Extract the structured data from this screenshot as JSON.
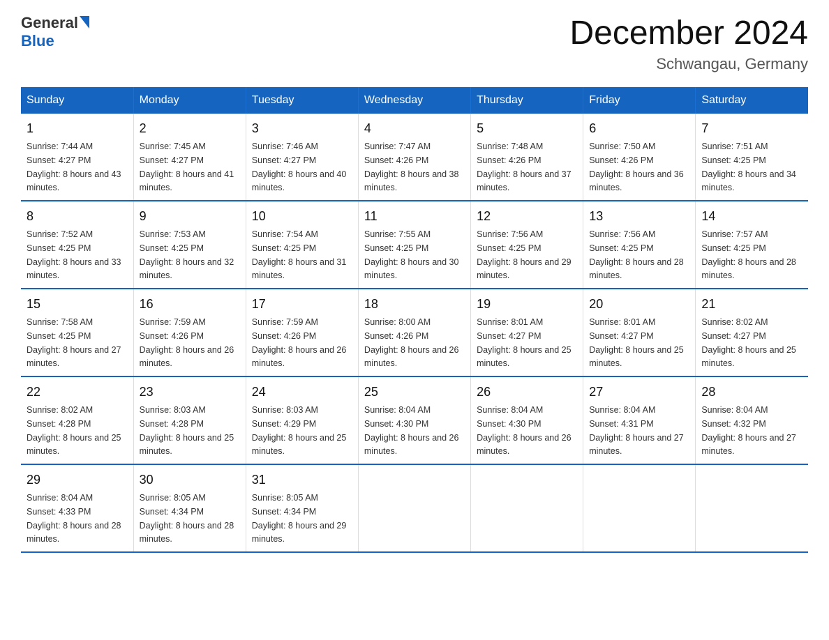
{
  "header": {
    "logo_text_general": "General",
    "logo_text_blue": "Blue",
    "main_title": "December 2024",
    "subtitle": "Schwangau, Germany"
  },
  "calendar": {
    "days_of_week": [
      "Sunday",
      "Monday",
      "Tuesday",
      "Wednesday",
      "Thursday",
      "Friday",
      "Saturday"
    ],
    "weeks": [
      [
        {
          "day": "1",
          "sunrise": "7:44 AM",
          "sunset": "4:27 PM",
          "daylight": "8 hours and 43 minutes."
        },
        {
          "day": "2",
          "sunrise": "7:45 AM",
          "sunset": "4:27 PM",
          "daylight": "8 hours and 41 minutes."
        },
        {
          "day": "3",
          "sunrise": "7:46 AM",
          "sunset": "4:27 PM",
          "daylight": "8 hours and 40 minutes."
        },
        {
          "day": "4",
          "sunrise": "7:47 AM",
          "sunset": "4:26 PM",
          "daylight": "8 hours and 38 minutes."
        },
        {
          "day": "5",
          "sunrise": "7:48 AM",
          "sunset": "4:26 PM",
          "daylight": "8 hours and 37 minutes."
        },
        {
          "day": "6",
          "sunrise": "7:50 AM",
          "sunset": "4:26 PM",
          "daylight": "8 hours and 36 minutes."
        },
        {
          "day": "7",
          "sunrise": "7:51 AM",
          "sunset": "4:25 PM",
          "daylight": "8 hours and 34 minutes."
        }
      ],
      [
        {
          "day": "8",
          "sunrise": "7:52 AM",
          "sunset": "4:25 PM",
          "daylight": "8 hours and 33 minutes."
        },
        {
          "day": "9",
          "sunrise": "7:53 AM",
          "sunset": "4:25 PM",
          "daylight": "8 hours and 32 minutes."
        },
        {
          "day": "10",
          "sunrise": "7:54 AM",
          "sunset": "4:25 PM",
          "daylight": "8 hours and 31 minutes."
        },
        {
          "day": "11",
          "sunrise": "7:55 AM",
          "sunset": "4:25 PM",
          "daylight": "8 hours and 30 minutes."
        },
        {
          "day": "12",
          "sunrise": "7:56 AM",
          "sunset": "4:25 PM",
          "daylight": "8 hours and 29 minutes."
        },
        {
          "day": "13",
          "sunrise": "7:56 AM",
          "sunset": "4:25 PM",
          "daylight": "8 hours and 28 minutes."
        },
        {
          "day": "14",
          "sunrise": "7:57 AM",
          "sunset": "4:25 PM",
          "daylight": "8 hours and 28 minutes."
        }
      ],
      [
        {
          "day": "15",
          "sunrise": "7:58 AM",
          "sunset": "4:25 PM",
          "daylight": "8 hours and 27 minutes."
        },
        {
          "day": "16",
          "sunrise": "7:59 AM",
          "sunset": "4:26 PM",
          "daylight": "8 hours and 26 minutes."
        },
        {
          "day": "17",
          "sunrise": "7:59 AM",
          "sunset": "4:26 PM",
          "daylight": "8 hours and 26 minutes."
        },
        {
          "day": "18",
          "sunrise": "8:00 AM",
          "sunset": "4:26 PM",
          "daylight": "8 hours and 26 minutes."
        },
        {
          "day": "19",
          "sunrise": "8:01 AM",
          "sunset": "4:27 PM",
          "daylight": "8 hours and 25 minutes."
        },
        {
          "day": "20",
          "sunrise": "8:01 AM",
          "sunset": "4:27 PM",
          "daylight": "8 hours and 25 minutes."
        },
        {
          "day": "21",
          "sunrise": "8:02 AM",
          "sunset": "4:27 PM",
          "daylight": "8 hours and 25 minutes."
        }
      ],
      [
        {
          "day": "22",
          "sunrise": "8:02 AM",
          "sunset": "4:28 PM",
          "daylight": "8 hours and 25 minutes."
        },
        {
          "day": "23",
          "sunrise": "8:03 AM",
          "sunset": "4:28 PM",
          "daylight": "8 hours and 25 minutes."
        },
        {
          "day": "24",
          "sunrise": "8:03 AM",
          "sunset": "4:29 PM",
          "daylight": "8 hours and 25 minutes."
        },
        {
          "day": "25",
          "sunrise": "8:04 AM",
          "sunset": "4:30 PM",
          "daylight": "8 hours and 26 minutes."
        },
        {
          "day": "26",
          "sunrise": "8:04 AM",
          "sunset": "4:30 PM",
          "daylight": "8 hours and 26 minutes."
        },
        {
          "day": "27",
          "sunrise": "8:04 AM",
          "sunset": "4:31 PM",
          "daylight": "8 hours and 27 minutes."
        },
        {
          "day": "28",
          "sunrise": "8:04 AM",
          "sunset": "4:32 PM",
          "daylight": "8 hours and 27 minutes."
        }
      ],
      [
        {
          "day": "29",
          "sunrise": "8:04 AM",
          "sunset": "4:33 PM",
          "daylight": "8 hours and 28 minutes."
        },
        {
          "day": "30",
          "sunrise": "8:05 AM",
          "sunset": "4:34 PM",
          "daylight": "8 hours and 28 minutes."
        },
        {
          "day": "31",
          "sunrise": "8:05 AM",
          "sunset": "4:34 PM",
          "daylight": "8 hours and 29 minutes."
        },
        null,
        null,
        null,
        null
      ]
    ]
  }
}
